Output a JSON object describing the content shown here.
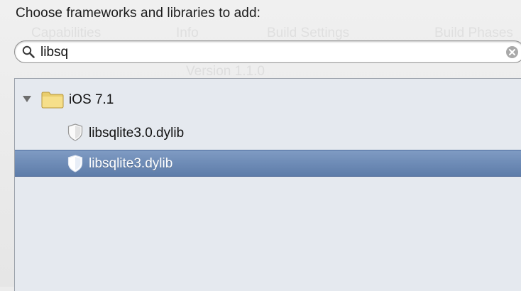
{
  "dialog": {
    "prompt": "Choose frameworks and libraries to add:"
  },
  "background": {
    "tabs": [
      "Capabilities",
      "Info",
      "Build Settings",
      "Build Phases"
    ],
    "version_text": "Version  1.1.0"
  },
  "search": {
    "query": "libsq",
    "icon": "magnifier-icon",
    "clear_icon": "clear-circle-icon"
  },
  "results": {
    "group": {
      "label": "iOS 7.1",
      "expanded": true,
      "icon": "folder-icon"
    },
    "items": [
      {
        "label": "libsqlite3.0.dylib",
        "icon": "library-shield-icon",
        "selected": false
      },
      {
        "label": "libsqlite3.dylib",
        "icon": "library-shield-icon",
        "selected": true
      }
    ]
  },
  "colors": {
    "selection": "#6a88b6",
    "list_background": "#e5e9ef",
    "window_background": "#ececec"
  }
}
